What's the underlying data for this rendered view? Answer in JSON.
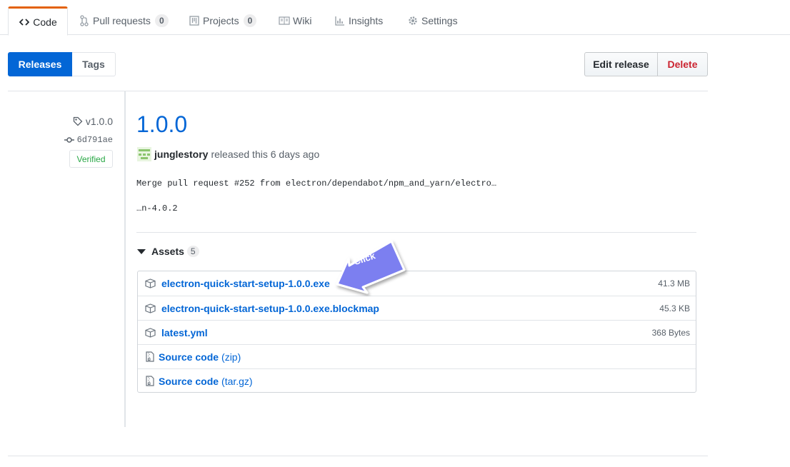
{
  "tabs": [
    {
      "label": "Code",
      "icon": "code-icon",
      "selected": true
    },
    {
      "label": "Pull requests",
      "icon": "pull-request-icon",
      "count": "0"
    },
    {
      "label": "Projects",
      "icon": "project-icon",
      "count": "0"
    },
    {
      "label": "Wiki",
      "icon": "book-icon"
    },
    {
      "label": "Insights",
      "icon": "graph-icon"
    },
    {
      "label": "Settings",
      "icon": "gear-icon"
    }
  ],
  "subnav": {
    "releases": "Releases",
    "tags": "Tags"
  },
  "actions": {
    "edit": "Edit release",
    "delete": "Delete"
  },
  "meta": {
    "tag": "v1.0.0",
    "commit": "6d791ae",
    "verified": "Verified"
  },
  "release": {
    "title": "1.0.0",
    "author": "junglestory",
    "released_text": "released this 6 days ago",
    "body_line1": "Merge pull request #252 from electron/dependabot/npm_and_yarn/electro…",
    "body_line2": "…n-4.0.2"
  },
  "assets": {
    "label": "Assets",
    "count": "5",
    "items": [
      {
        "name": "electron-quick-start-setup-1.0.0.exe",
        "size": "41.3 MB",
        "icon": "package-icon"
      },
      {
        "name": "electron-quick-start-setup-1.0.0.exe.blockmap",
        "size": "45.3 KB",
        "icon": "package-icon"
      },
      {
        "name": "latest.yml",
        "size": "368 Bytes",
        "icon": "package-icon"
      },
      {
        "name": "Source code",
        "sub": "(zip)",
        "icon": "file-zip-icon"
      },
      {
        "name": "Source code",
        "sub": "(tar.gz)",
        "icon": "file-zip-icon"
      }
    ]
  },
  "callout": {
    "label": "Click",
    "color": "#7b7ff0"
  },
  "colors": {
    "accent": "#0366d6",
    "tab_underline": "#e36209",
    "danger": "#cb2431",
    "success": "#28a745"
  }
}
